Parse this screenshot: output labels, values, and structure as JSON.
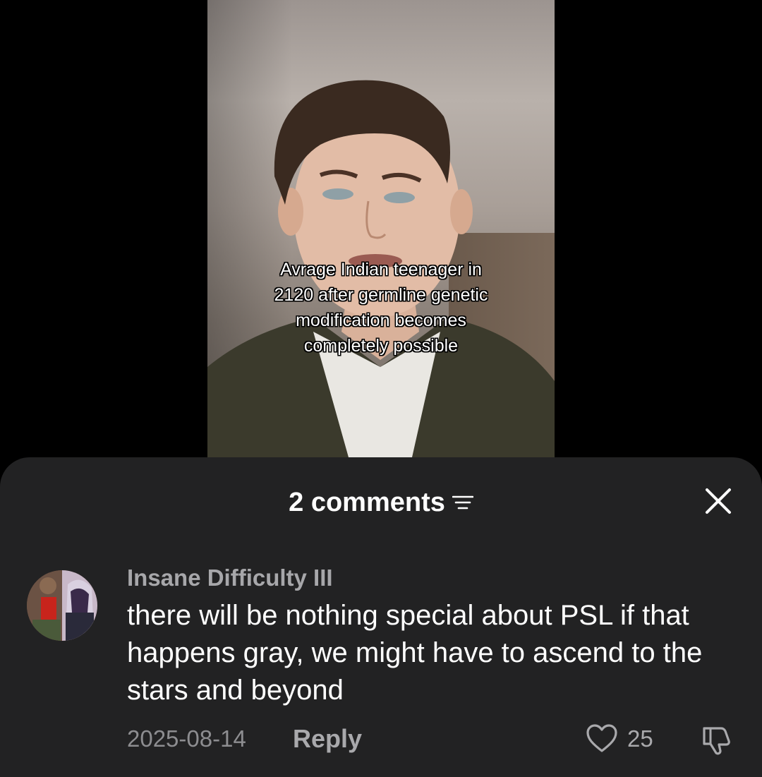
{
  "video": {
    "caption": "Avrage Indian teenager in\n2120 after germline genetic\nmodification becomes\ncompletely possible"
  },
  "comments_sheet": {
    "title": "2 comments",
    "sort_icon": "sort-lines-icon",
    "close_icon": "close-x-icon",
    "background_color": "#222223"
  },
  "comments": [
    {
      "username": "Insane Difficulty III",
      "text": "there will be nothing special about PSL if that happens gray, we might have to ascend to the stars and beyond",
      "date": "2025-08-14",
      "reply_label": "Reply",
      "likes": "25",
      "like_icon": "heart-outline-icon",
      "dislike_icon": "thumbs-down-icon"
    }
  ]
}
